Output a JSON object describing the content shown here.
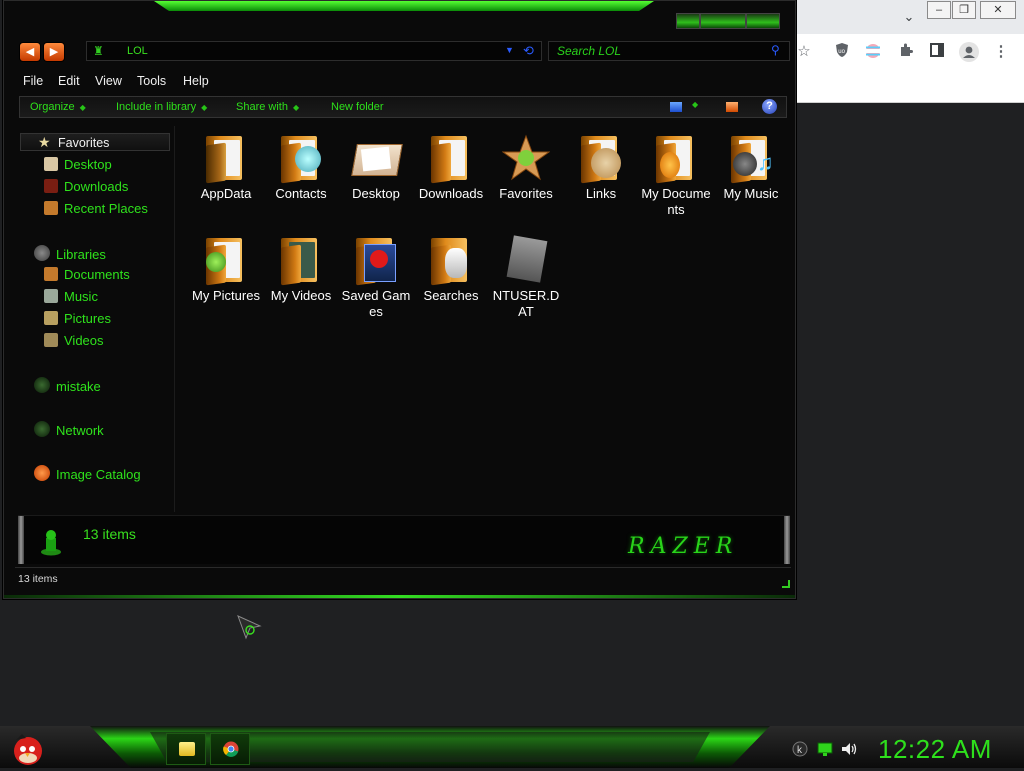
{
  "window": {
    "address": "LOL",
    "search_placeholder": "Search LOL",
    "menu": [
      "File",
      "Edit",
      "View",
      "Tools",
      "Help"
    ],
    "commands": [
      "Organize",
      "Include in library",
      "Share with",
      "New folder"
    ],
    "help_symbol": "?"
  },
  "nav": {
    "favorites_label": "Favorites",
    "favorites": [
      "Desktop",
      "Downloads",
      "Recent Places"
    ],
    "libraries_label": "Libraries",
    "libraries": [
      "Documents",
      "Music",
      "Pictures",
      "Videos"
    ],
    "other": [
      "mistake",
      "Network",
      "Image Catalog"
    ]
  },
  "files": [
    {
      "name": "AppData",
      "icon": "folder-icon"
    },
    {
      "name": "Contacts",
      "icon": "contacts-folder-icon"
    },
    {
      "name": "Desktop",
      "icon": "desktop-icon"
    },
    {
      "name": "Downloads",
      "icon": "downloads-folder-icon"
    },
    {
      "name": "Favorites",
      "icon": "favorites-star-icon"
    },
    {
      "name": "Links",
      "icon": "links-folder-icon"
    },
    {
      "name": "My Documents",
      "icon": "documents-folder-icon"
    },
    {
      "name": "My Music",
      "icon": "music-folder-icon"
    },
    {
      "name": "My Pictures",
      "icon": "pictures-folder-icon"
    },
    {
      "name": "My Videos",
      "icon": "videos-folder-icon"
    },
    {
      "name": "Saved Games",
      "icon": "saved-games-folder-icon"
    },
    {
      "name": "Searches",
      "icon": "searches-folder-icon"
    },
    {
      "name": "NTUSER.DAT",
      "icon": "file-icon"
    }
  ],
  "details": {
    "count": "13 items",
    "brand": "RAZER"
  },
  "status": "13 items",
  "taskbar": {
    "clock": "12:22 AM"
  },
  "browser": {
    "chevron": "⌄",
    "minimize": "–",
    "restore": "❐",
    "close": "✕"
  },
  "colors": {
    "accent": "#2ee01b",
    "window_bg": "#0a0a0a",
    "desktop_bg": "#1f2022"
  }
}
